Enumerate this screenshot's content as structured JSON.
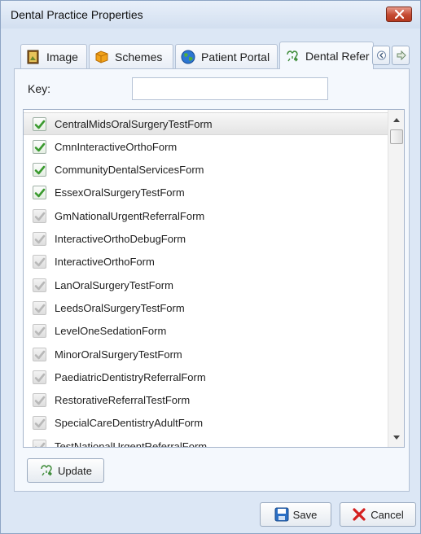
{
  "window": {
    "title": "Dental Practice Properties"
  },
  "tabs": [
    {
      "label": "Image",
      "icon": "image-icon"
    },
    {
      "label": "Schemes",
      "icon": "puzzle-icon"
    },
    {
      "label": "Patient Portal",
      "icon": "globe-icon"
    },
    {
      "label": "Dental Refer",
      "icon": "referral-icon",
      "active": true
    }
  ],
  "key": {
    "label": "Key:",
    "value": "",
    "placeholder": ""
  },
  "forms": [
    {
      "name": "CentralMidsOralSurgeryTestForm",
      "checked": true,
      "selected": true
    },
    {
      "name": "CmnInteractiveOrthoForm",
      "checked": true
    },
    {
      "name": "CommunityDentalServicesForm",
      "checked": true
    },
    {
      "name": "EssexOralSurgeryTestForm",
      "checked": true
    },
    {
      "name": "GmNationalUrgentReferralForm",
      "checked": false
    },
    {
      "name": "InteractiveOrthoDebugForm",
      "checked": false
    },
    {
      "name": "InteractiveOrthoForm",
      "checked": false
    },
    {
      "name": "LanOralSurgeryTestForm",
      "checked": false
    },
    {
      "name": "LeedsOralSurgeryTestForm",
      "checked": false
    },
    {
      "name": "LevelOneSedationForm",
      "checked": false
    },
    {
      "name": "MinorOralSurgeryTestForm",
      "checked": false
    },
    {
      "name": "PaediatricDentistryReferralForm",
      "checked": false
    },
    {
      "name": "RestorativeReferralTestForm",
      "checked": false
    },
    {
      "name": "SpecialCareDentistryAdultForm",
      "checked": false
    },
    {
      "name": "TestNationalUrgentReferralForm",
      "checked": false
    }
  ],
  "buttons": {
    "update": "Update",
    "save": "Save",
    "cancel": "Cancel"
  },
  "colors": {
    "check_green": "#3a9a2f",
    "check_grey": "#b8b8b8",
    "cancel_red": "#d42020",
    "save_blue": "#2b6fc4"
  }
}
